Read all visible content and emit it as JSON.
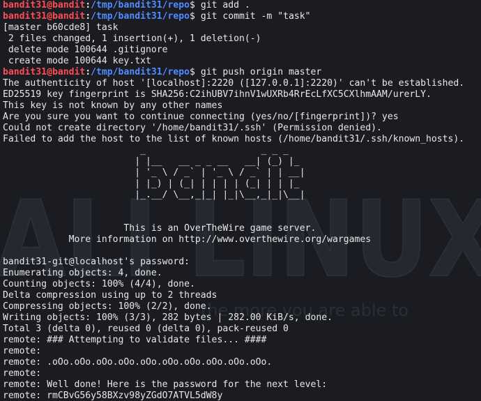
{
  "wallpaper": {
    "brand_text": "ALI LINUX",
    "slogan": "the more you are able to"
  },
  "lines": [
    {
      "type": "prompt",
      "user": "bandit31@bandit",
      "path": "/tmp/bandit31/repo",
      "cmd": "git add ."
    },
    {
      "type": "prompt",
      "user": "bandit31@bandit",
      "path": "/tmp/bandit31/repo",
      "cmd": "git commit -m \"task\""
    },
    {
      "type": "out",
      "text": "[master b60cde8] task"
    },
    {
      "type": "out",
      "text": " 2 files changed, 1 insertion(+), 1 deletion(-)"
    },
    {
      "type": "out",
      "text": " delete mode 100644 .gitignore"
    },
    {
      "type": "out",
      "text": " create mode 100644 key.txt"
    },
    {
      "type": "prompt",
      "user": "bandit31@bandit",
      "path": "/tmp/bandit31/repo",
      "cmd": "git push origin master"
    },
    {
      "type": "out",
      "text": "The authenticity of host '[localhost]:2220 ([127.0.0.1]:2220)' can't be established."
    },
    {
      "type": "out",
      "text": "ED25519 key fingerprint is SHA256:C2ihUBV7ihnV1wUXRb4RrEcLfXC5CXlhmAAM/urerLY."
    },
    {
      "type": "out",
      "text": "This key is not known by any other names"
    },
    {
      "type": "out",
      "text": "Are you sure you want to continue connecting (yes/no/[fingerprint])? yes"
    },
    {
      "type": "out",
      "text": "Could not create directory '/home/bandit31/.ssh' (Permission denied)."
    },
    {
      "type": "out",
      "text": "Failed to add the host to the list of known hosts (/home/bandit31/.ssh/known_hosts)."
    },
    {
      "type": "out",
      "text": "                         _                     _ _ _"
    },
    {
      "type": "out",
      "text": "                        | |__   __ _ _ __   __| (_) |_"
    },
    {
      "type": "out",
      "text": "                        | '_ \\ / _` | '_ \\ / _` | | __|"
    },
    {
      "type": "out",
      "text": "                        | |_) | (_| | | | | (_| | | |_"
    },
    {
      "type": "out",
      "text": "                        |_.__/ \\__,_|_| |_|\\__,_|_|\\__|"
    },
    {
      "type": "out",
      "text": ""
    },
    {
      "type": "out",
      "text": ""
    },
    {
      "type": "out",
      "text": "                      This is an OverTheWire game server."
    },
    {
      "type": "out",
      "text": "            More information on http://www.overthewire.org/wargames"
    },
    {
      "type": "out",
      "text": ""
    },
    {
      "type": "out",
      "text": "bandit31-git@localhost's password:"
    },
    {
      "type": "out",
      "text": "Enumerating objects: 4, done."
    },
    {
      "type": "out",
      "text": "Counting objects: 100% (4/4), done."
    },
    {
      "type": "out",
      "text": "Delta compression using up to 2 threads"
    },
    {
      "type": "out",
      "text": "Compressing objects: 100% (2/2), done."
    },
    {
      "type": "out",
      "text": "Writing objects: 100% (3/3), 282 bytes | 282.00 KiB/s, done."
    },
    {
      "type": "out",
      "text": "Total 3 (delta 0), reused 0 (delta 0), pack-reused 0"
    },
    {
      "type": "out",
      "text": "remote: ### Attempting to validate files... ####"
    },
    {
      "type": "out",
      "text": "remote:"
    },
    {
      "type": "out",
      "text": "remote: .oOo.oOo.oOo.oOo.oOo.oOo.oOo.oOo.oOo.oOo."
    },
    {
      "type": "out",
      "text": "remote:"
    },
    {
      "type": "out",
      "text": "remote: Well done! Here is the password for the next level:"
    },
    {
      "type": "out",
      "text": "remote: rmCBvG56y58BXzv98yZGdO7ATVL5dW8y"
    }
  ]
}
